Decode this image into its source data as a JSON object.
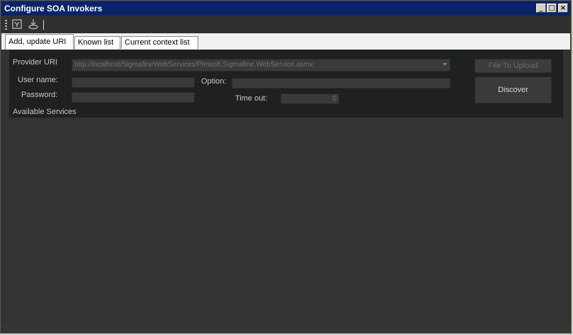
{
  "window": {
    "title": "Configure SOA Invokers",
    "controls": {
      "minimize": "_",
      "maximize": "□",
      "close": "×"
    }
  },
  "toolbar": {
    "icons": [
      "network-icon",
      "deploy-icon"
    ]
  },
  "tabs": [
    {
      "label": "Add, update URI",
      "active": true
    },
    {
      "label": "Known list",
      "active": false
    },
    {
      "label": "Current context list",
      "active": false
    }
  ],
  "form": {
    "provider_uri_label": "Provider URI",
    "provider_uri_value": "http://localhost/SigmafineWebServices/Pimsoft.Sigmafine.WebService.asmx",
    "username_label": "User name:",
    "username_value": "",
    "password_label": "Password:",
    "password_value": "",
    "option_label": "Option:",
    "option_value": "",
    "timeout_label": "Time out:",
    "timeout_value": "0",
    "file_upload_button": "File To Upload",
    "discover_button": "Discover",
    "available_services_label": "Available Services"
  }
}
